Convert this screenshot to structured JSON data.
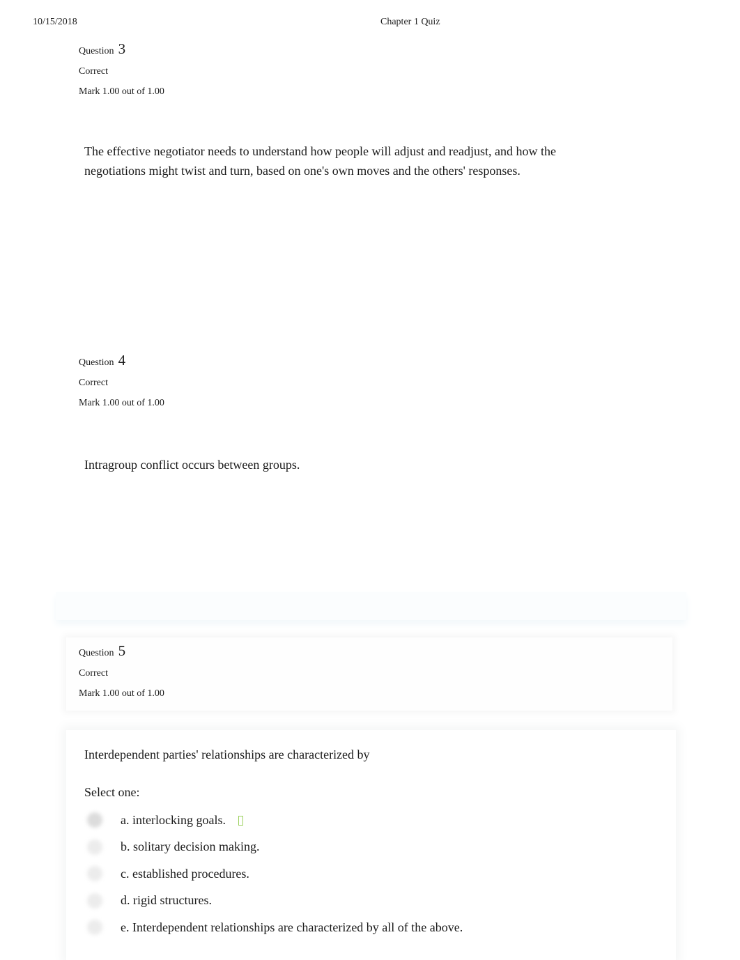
{
  "header": {
    "date": "10/15/2018",
    "title": "Chapter 1 Quiz"
  },
  "questions": [
    {
      "label": "Question",
      "number": "3",
      "state": "Correct",
      "grade": "Mark 1.00 out of 1.00",
      "text": "The effective negotiator needs to understand how people will adjust and readjust, and how the negotiations might twist and turn, based on one's own moves and the others' responses."
    },
    {
      "label": "Question",
      "number": "4",
      "state": "Correct",
      "grade": "Mark 1.00 out of 1.00",
      "text": "Intragroup conflict occurs between groups."
    },
    {
      "label": "Question",
      "number": "5",
      "state": "Correct",
      "grade": "Mark 1.00 out of 1.00",
      "text": "Interdependent parties' relationships are characterized by",
      "prompt": "Select one:",
      "answers": [
        {
          "label": "a. interlocking goals.",
          "selected": true,
          "correct_icon": "check-icon"
        },
        {
          "label": "b. solitary decision making.",
          "selected": false
        },
        {
          "label": "c. established procedures.",
          "selected": false
        },
        {
          "label": "d. rigid structures.",
          "selected": false
        },
        {
          "label": "e. Interdependent relationships are characterized by all of the above.",
          "selected": false
        }
      ]
    }
  ],
  "colors": {
    "correct_icon": "#9cd15e"
  }
}
